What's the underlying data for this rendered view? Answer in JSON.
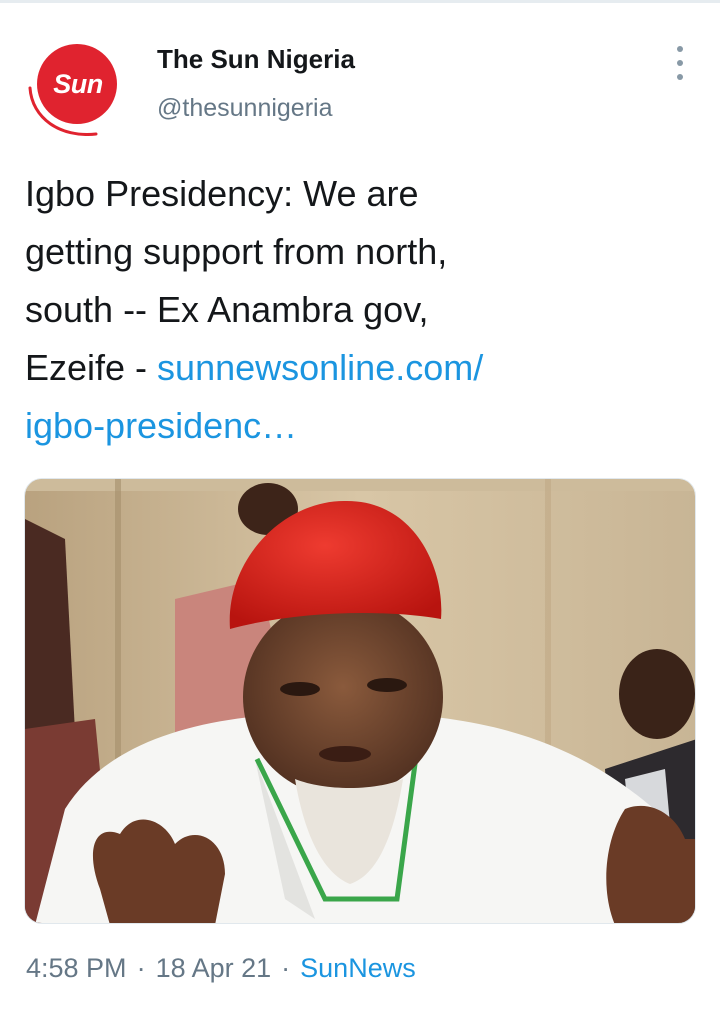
{
  "account": {
    "display_name": "The Sun Nigeria",
    "handle": "@thesunnigeria",
    "avatar_logo_text": "Sun",
    "avatar_color": "#e0232f"
  },
  "tweet": {
    "text_lines": [
      "Igbo Presidency: We are",
      "getting support from north,",
      "south -- Ex Anambra gov,"
    ],
    "last_line_prefix": "Ezeife - ",
    "link_line1": "sunnewsonline.com/",
    "link_line2": "igbo-presidenc…",
    "link_color": "#1b95e0"
  },
  "media": {
    "icon": "photo-image"
  },
  "meta": {
    "time": "4:58 PM",
    "separator": "·",
    "date": "18 Apr 21",
    "source": "SunNews"
  },
  "icons": {
    "more": "more-vertical-icon"
  }
}
